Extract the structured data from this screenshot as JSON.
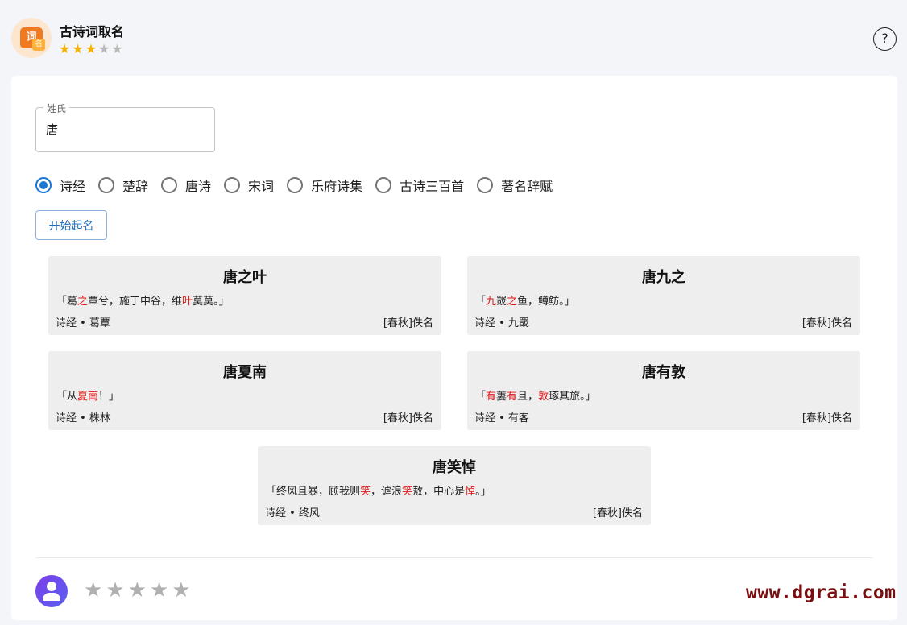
{
  "app": {
    "logo_text": "词",
    "logo_sub": "名",
    "title": "古诗词取名",
    "rating": 3,
    "rating_max": 5,
    "help_symbol": "?"
  },
  "form": {
    "surname_label": "姓氏",
    "surname_value": "唐",
    "sources": [
      "诗经",
      "楚辞",
      "唐诗",
      "宋词",
      "乐府诗集",
      "古诗三百首",
      "著名辞赋"
    ],
    "selected_source": "诗经",
    "start_label": "开始起名"
  },
  "results": [
    {
      "name": "唐之叶",
      "verse": [
        {
          "t": "「葛",
          "h": false
        },
        {
          "t": "之",
          "h": true
        },
        {
          "t": "覃兮，施于中谷，维",
          "h": false
        },
        {
          "t": "叶",
          "h": true
        },
        {
          "t": "莫莫。」",
          "h": false
        }
      ],
      "source": "诗经 • 葛覃",
      "author": "[春秋]佚名"
    },
    {
      "name": "唐九之",
      "verse": [
        {
          "t": "「",
          "h": false
        },
        {
          "t": "九",
          "h": true
        },
        {
          "t": "罭",
          "h": false
        },
        {
          "t": "之",
          "h": true
        },
        {
          "t": "鱼，鳟鲂。」",
          "h": false
        }
      ],
      "source": "诗经 • 九罭",
      "author": "[春秋]佚名"
    },
    {
      "name": "唐夏南",
      "verse": [
        {
          "t": "「从",
          "h": false
        },
        {
          "t": "夏南",
          "h": true
        },
        {
          "t": "！」",
          "h": false
        }
      ],
      "source": "诗经 • 株林",
      "author": "[春秋]佚名"
    },
    {
      "name": "唐有敦",
      "verse": [
        {
          "t": "「",
          "h": false
        },
        {
          "t": "有",
          "h": true
        },
        {
          "t": "萋",
          "h": false
        },
        {
          "t": "有",
          "h": true
        },
        {
          "t": "且，",
          "h": false
        },
        {
          "t": "敦",
          "h": true
        },
        {
          "t": "琢其旅。」",
          "h": false
        }
      ],
      "source": "诗经 • 有客",
      "author": "[春秋]佚名"
    },
    {
      "name": "唐笑悼",
      "verse": [
        {
          "t": "「终风且暴，顾我则",
          "h": false
        },
        {
          "t": "笑",
          "h": true
        },
        {
          "t": "，谑浪",
          "h": false
        },
        {
          "t": "笑",
          "h": true
        },
        {
          "t": "敖，中心是",
          "h": false
        },
        {
          "t": "悼",
          "h": true
        },
        {
          "t": "。」",
          "h": false
        }
      ],
      "source": "诗经 • 终风",
      "author": "[春秋]佚名"
    }
  ],
  "feedback": {
    "rating": 0,
    "rating_max": 5
  },
  "watermark": "www.dgrai.com",
  "colors": {
    "accent": "#1976d2",
    "highlight": "#e01818",
    "star_on": "#f5b400",
    "star_off": "#b9b9b9"
  }
}
